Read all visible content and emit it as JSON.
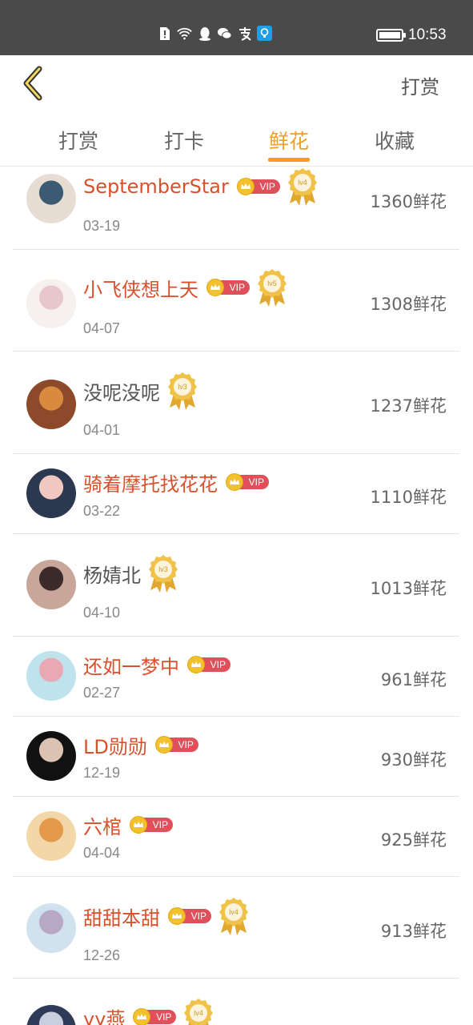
{
  "status_bar": {
    "time": "10:53"
  },
  "nav": {
    "action_label": "打赏"
  },
  "tabs": [
    {
      "label": "打赏",
      "active": false
    },
    {
      "label": "打卡",
      "active": false
    },
    {
      "label": "鲜花",
      "active": true
    },
    {
      "label": "收藏",
      "active": false
    }
  ],
  "vip_label": "VIP",
  "rows": [
    {
      "name": "SeptemberStar",
      "date": "03-19",
      "count": "1360鲜花",
      "vip": true,
      "medal": "lv4"
    },
    {
      "name": "小飞侠想上天",
      "date": "04-07",
      "count": "1308鲜花",
      "vip": true,
      "medal": "lv5"
    },
    {
      "name": "没呢没呢",
      "date": "04-01",
      "count": "1237鲜花",
      "vip": false,
      "medal": "lv3"
    },
    {
      "name": "骑着摩托找花花",
      "date": "03-22",
      "count": "1110鲜花",
      "vip": true,
      "medal": ""
    },
    {
      "name": "杨婧北",
      "date": "04-10",
      "count": "1013鲜花",
      "vip": false,
      "medal": "lv3"
    },
    {
      "name": "还如一梦中",
      "date": "02-27",
      "count": "961鲜花",
      "vip": true,
      "medal": ""
    },
    {
      "name": "LD勋勋",
      "date": "12-19",
      "count": "930鲜花",
      "vip": true,
      "medal": ""
    },
    {
      "name": "六棺",
      "date": "04-04",
      "count": "925鲜花",
      "vip": true,
      "medal": ""
    },
    {
      "name": "甜甜本甜",
      "date": "12-26",
      "count": "913鲜花",
      "vip": true,
      "medal": "lv4"
    },
    {
      "name": "yy燕",
      "date": "",
      "count": "",
      "vip": true,
      "medal": "lv4"
    }
  ]
}
